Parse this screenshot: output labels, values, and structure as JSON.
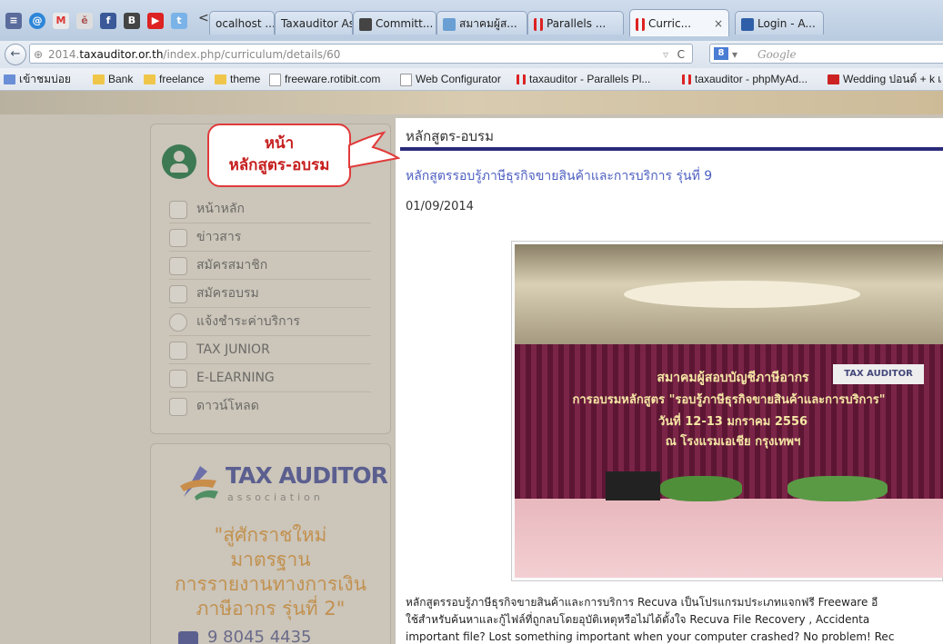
{
  "browser": {
    "tabs": [
      {
        "label": "ocalhost ...",
        "icon": "page-icon"
      },
      {
        "label": "Taxauditor As...",
        "icon": ""
      },
      {
        "label": "Committ...",
        "icon": "blogger-icon"
      },
      {
        "label": "สมาคมผู้ส...",
        "icon": "site-icon"
      },
      {
        "label": "Parallels ...",
        "icon": "parallels-icon"
      },
      {
        "label": "Curric...",
        "icon": "parallels-icon",
        "active": true
      },
      {
        "label": "Login - A...",
        "icon": "blogger-icon"
      }
    ],
    "tab_close": "×",
    "tab_back": "<",
    "url": {
      "prefix": "2014.",
      "host": "taxauditor.or.th",
      "path": "/index.php/curriculum/details/60"
    },
    "reload": "C",
    "search_placeholder": "Google",
    "bookmarks": [
      "เข้าชมบ่อย",
      "Bank",
      "freelance",
      "theme",
      "freeware.rotibit.com",
      "Web Configurator",
      "taxauditor - Parallels Pl...",
      "taxauditor - phpMyAd...",
      "Wedding ปอนด์ + k เ"
    ]
  },
  "sidebar": {
    "nav": [
      "หน้าหลัก",
      "ข่าวสาร",
      "สมัครสมาชิก",
      "สมัครอบรม",
      "แจ้งชำระค่าบริการ",
      "TAX JUNIOR",
      "E-LEARNING",
      "ดาวน์โหลด"
    ]
  },
  "ad": {
    "logo_text": "TAX AUDITOR",
    "logo_sub": "association",
    "lines": [
      "\"สู่ศักราชใหม่",
      "มาตรฐาน",
      "การรายงานทางการเงิน",
      "ภาษีอากร รุ่นที่ 2\""
    ],
    "footer": "9 8045 4435"
  },
  "callout": {
    "line1": "หน้า",
    "line2": "หลักสูตร-อบรม"
  },
  "content": {
    "heading": "หลักสูตร-อบรม",
    "article_title": "หลักสูตรรอบรู้ภาษีธุรกิจขายสินค้าและการบริการ รุ่นที่ 9",
    "date": "01/09/2014",
    "photo": {
      "banner_line1": "สมาคมผู้สอบบัญชีภาษีอากร",
      "banner_logo": "TAX AUDITOR",
      "banner_line2": "การอบรมหลักสูตร \"รอบรู้ภาษีธุรกิจขายสินค้าและการบริการ\"",
      "banner_line3": "วันที่ 12-13 มกราคม 2556",
      "banner_line4": "ณ โรงแรมเอเชีย กรุงเทพฯ"
    },
    "body": [
      "หลักสูตรรอบรู้ภาษีธุรกิจขายสินค้าและการบริการ Recuva เป็นโปรแกรมประเภทแจกฟรี Freeware อี",
      "ใช้สำหรับค้นหาและกู้ไฟล์ที่ถูกลบโดยอุบัติเหตุหรือไม่ได้ตั้งใจ Recuva File Recovery , Accidenta",
      "important file? Lost something important when your computer crashed? No problem! Rec"
    ]
  },
  "colors": {
    "accent_rule": "#2a2a7a",
    "link": "#4d5ec0",
    "callout_red": "#e03b3b",
    "sidebar_green": "#3d7a53"
  }
}
